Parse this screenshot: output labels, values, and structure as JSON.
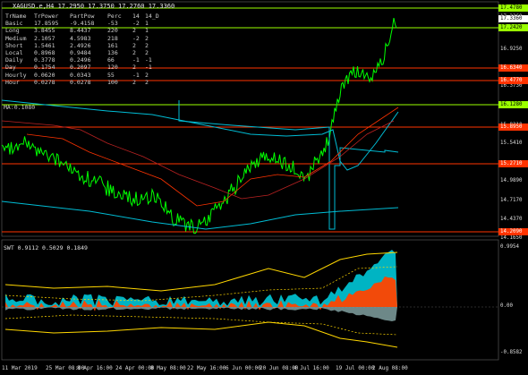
{
  "header": {
    "title": "XAGUSD.e,H4  17.2950 17.3750 17.2760 17.3360"
  },
  "indicator_table": {
    "columns": [
      "TrName",
      "TrPower",
      "PartPow",
      "Perc",
      "14",
      "14_D"
    ],
    "rows": [
      [
        "Basic",
        "17.8595",
        "-9.4158",
        "-53",
        "-2",
        "1"
      ],
      [
        "Long",
        "3.8455",
        "8.4437",
        "220",
        "2",
        "1"
      ],
      [
        "Medium",
        "2.1057",
        "4.5983",
        "218",
        "-2",
        "2"
      ],
      [
        "Short",
        "1.5461",
        "2.4926",
        "161",
        "2",
        "2"
      ],
      [
        "Local",
        "0.8968",
        "0.9484",
        "136",
        "2",
        "2"
      ],
      [
        "Daily",
        "0.3778",
        "0.2496",
        "66",
        "-1",
        "-1"
      ],
      [
        "Day",
        "0.1754",
        "0.2097",
        "120",
        "2",
        "-1"
      ],
      [
        "Hourly",
        "0.0620",
        "0.0343",
        "55",
        "-1",
        "2"
      ],
      [
        "Hour",
        "0.0278",
        "0.0278",
        "100",
        "2",
        "2"
      ]
    ],
    "ma_label": "MA:0.1080"
  },
  "price_axis": {
    "ticks": [
      "17.3360",
      "16.9250",
      "16.3730",
      "15.8210",
      "15.5410",
      "14.9890",
      "14.7170",
      "14.4370",
      "14.1650"
    ],
    "tags": [
      {
        "text": "17.4780",
        "bg": "#9aff00",
        "fg": "#000000"
      },
      {
        "text": "17.3360",
        "bg": "#ffffff",
        "fg": "#000000"
      },
      {
        "text": "17.2420",
        "bg": "#9aff00",
        "fg": "#000000"
      },
      {
        "text": "16.6340",
        "bg": "#ff3300",
        "fg": "#ffffff"
      },
      {
        "text": "16.4770",
        "bg": "#ff3300",
        "fg": "#ffffff"
      },
      {
        "text": "16.1280",
        "bg": "#9aff00",
        "fg": "#000000"
      },
      {
        "text": "15.8950",
        "bg": "#ff3300",
        "fg": "#ffffff"
      },
      {
        "text": "15.2710",
        "bg": "#ff3300",
        "fg": "#ffffff"
      },
      {
        "text": "14.2090",
        "bg": "#ff3300",
        "fg": "#ffffff"
      }
    ]
  },
  "subwindow": {
    "title": "SWT 0.9112 0.5029 0.1849",
    "ticks": [
      "0.9954",
      "0.00",
      "-0.8582"
    ]
  },
  "time_axis": [
    "11 Mar 2019",
    "25 Mar 08:00",
    "8 Apr 16:00",
    "24 Apr 00:00",
    "8 May 08:00",
    "22 May 16:00",
    "6 Jun 00:00",
    "20 Jun 08:00",
    "4 Jul 16:00",
    "19 Jul 00:00",
    "2 Aug 08:00"
  ],
  "colors": {
    "price_line": "#00ff00",
    "resistance": "#ff3300",
    "support": "#9aff00",
    "ma_cyan": "#00bcd4",
    "swt_orange": "#ff4500",
    "swt_cyan": "#00c8d8",
    "swt_yellow": "#ffd700"
  }
}
